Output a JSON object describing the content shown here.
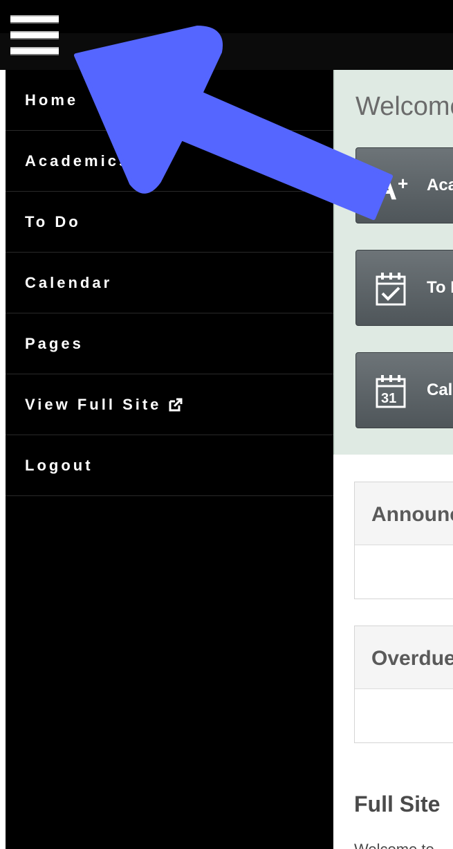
{
  "header": {
    "menu_icon": "hamburger-menu-icon"
  },
  "sidebar": {
    "items": [
      {
        "label": "Home"
      },
      {
        "label": "Academics"
      },
      {
        "label": "To Do"
      },
      {
        "label": "Calendar"
      },
      {
        "label": "Pages"
      },
      {
        "label": "View Full Site",
        "icon": "external-link-icon"
      },
      {
        "label": "Logout"
      }
    ]
  },
  "main": {
    "welcome": "Welcome",
    "tiles": [
      {
        "label": "Academics",
        "icon": "grade-a-plus-icon"
      },
      {
        "label": "To Do",
        "icon": "calendar-check-icon"
      },
      {
        "label": "Calendar",
        "icon": "calendar-31-icon"
      }
    ],
    "panels": [
      {
        "title": "Announcements"
      },
      {
        "title": "Overdue"
      }
    ],
    "section_title": "Full Site",
    "section_text": "Welcome to"
  },
  "annotation": {
    "arrow_color": "#5566ff"
  }
}
